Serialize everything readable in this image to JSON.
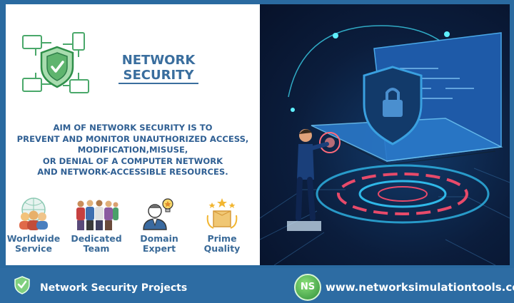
{
  "header": {
    "title_line1": "NETWORK",
    "title_line2": "SECURITY"
  },
  "aim": {
    "text": "AIM OF NETWORK SECURITY IS TO\nPREVENT AND MONITOR UNAUTHORIZED ACCESS,\nMODIFICATION,MISUSE,\nOR DENIAL OF A COMPUTER NETWORK\nAND NETWORK-ACCESSIBLE RESOURCES."
  },
  "features": [
    {
      "label": "Worldwide\nService",
      "icon": "globe-people-icon"
    },
    {
      "label": "Dedicated\nTeam",
      "icon": "team-icon"
    },
    {
      "label": "Domain\nExpert",
      "icon": "expert-icon"
    },
    {
      "label": "Prime\nQuality",
      "icon": "quality-box-icon"
    }
  ],
  "footer": {
    "left_label": "Network Security Projects",
    "badge": "NS",
    "url": "www.networksimulationtools.com"
  },
  "colors": {
    "accent": "#2f5f93",
    "footer": "#2d6ca3",
    "shield_green": "#6fbf73"
  }
}
